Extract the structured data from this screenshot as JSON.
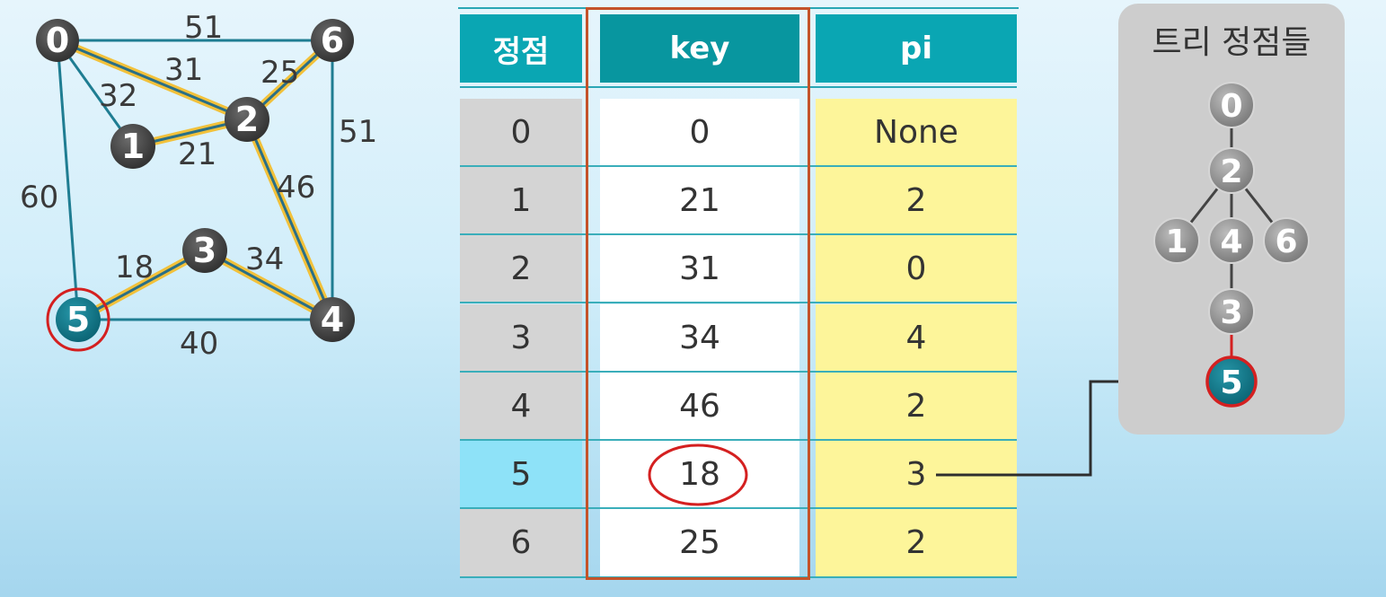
{
  "graph": {
    "nodes": [
      {
        "id": "n0",
        "label": "0",
        "selected": false
      },
      {
        "id": "n1",
        "label": "1",
        "selected": false
      },
      {
        "id": "n2",
        "label": "2",
        "selected": false
      },
      {
        "id": "n3",
        "label": "3",
        "selected": false
      },
      {
        "id": "n4",
        "label": "4",
        "selected": false
      },
      {
        "id": "n5",
        "label": "5",
        "selected": true
      },
      {
        "id": "n6",
        "label": "6",
        "selected": false
      }
    ],
    "edges": [
      {
        "from": "0",
        "to": "6",
        "weight": "51",
        "in_tree": false
      },
      {
        "from": "0",
        "to": "2",
        "weight": "31",
        "in_tree": true
      },
      {
        "from": "0",
        "to": "1",
        "weight": "32",
        "in_tree": false
      },
      {
        "from": "2",
        "to": "6",
        "weight": "25",
        "in_tree": true
      },
      {
        "from": "1",
        "to": "2",
        "weight": "21",
        "in_tree": true
      },
      {
        "from": "6",
        "to": "4",
        "weight": "51",
        "in_tree": false
      },
      {
        "from": "0",
        "to": "5",
        "weight": "60",
        "in_tree": false
      },
      {
        "from": "2",
        "to": "4",
        "weight": "46",
        "in_tree": true
      },
      {
        "from": "5",
        "to": "3",
        "weight": "18",
        "in_tree": true
      },
      {
        "from": "3",
        "to": "4",
        "weight": "34",
        "in_tree": true
      },
      {
        "from": "5",
        "to": "4",
        "weight": "40",
        "in_tree": false
      }
    ]
  },
  "table": {
    "headers": {
      "vertex": "정점",
      "key": "key",
      "pi": "pi"
    },
    "rows": [
      {
        "vertex": "0",
        "key": "0",
        "pi": "None"
      },
      {
        "vertex": "1",
        "key": "21",
        "pi": "2"
      },
      {
        "vertex": "2",
        "key": "31",
        "pi": "0"
      },
      {
        "vertex": "3",
        "key": "34",
        "pi": "4"
      },
      {
        "vertex": "4",
        "key": "46",
        "pi": "2"
      },
      {
        "vertex": "5",
        "key": "18",
        "pi": "3"
      },
      {
        "vertex": "6",
        "key": "25",
        "pi": "2"
      }
    ],
    "highlighted_row": 5
  },
  "tree": {
    "title": "트리 정점들",
    "nodes": [
      {
        "label": "0",
        "selected": false
      },
      {
        "label": "2",
        "selected": false
      },
      {
        "label": "1",
        "selected": false
      },
      {
        "label": "4",
        "selected": false
      },
      {
        "label": "6",
        "selected": false
      },
      {
        "label": "3",
        "selected": false
      },
      {
        "label": "5",
        "selected": true
      }
    ]
  },
  "colors": {
    "edge": "#1f7d92",
    "tree_edge_outer": "#f2c13a",
    "tree_edge_inner": "#2a6f86",
    "node": "#4a4a4a",
    "selected_node": "#15798a",
    "highlight_ring": "#d42020",
    "key_frame": "#c4532a",
    "header_bg": "#0aa6b3",
    "vertex_col_bg": "#d4d4d4",
    "pi_col_bg": "#fdf59a",
    "highlight_row_bg": "#8ee2f8",
    "tree_node": "#9a9a9a"
  }
}
